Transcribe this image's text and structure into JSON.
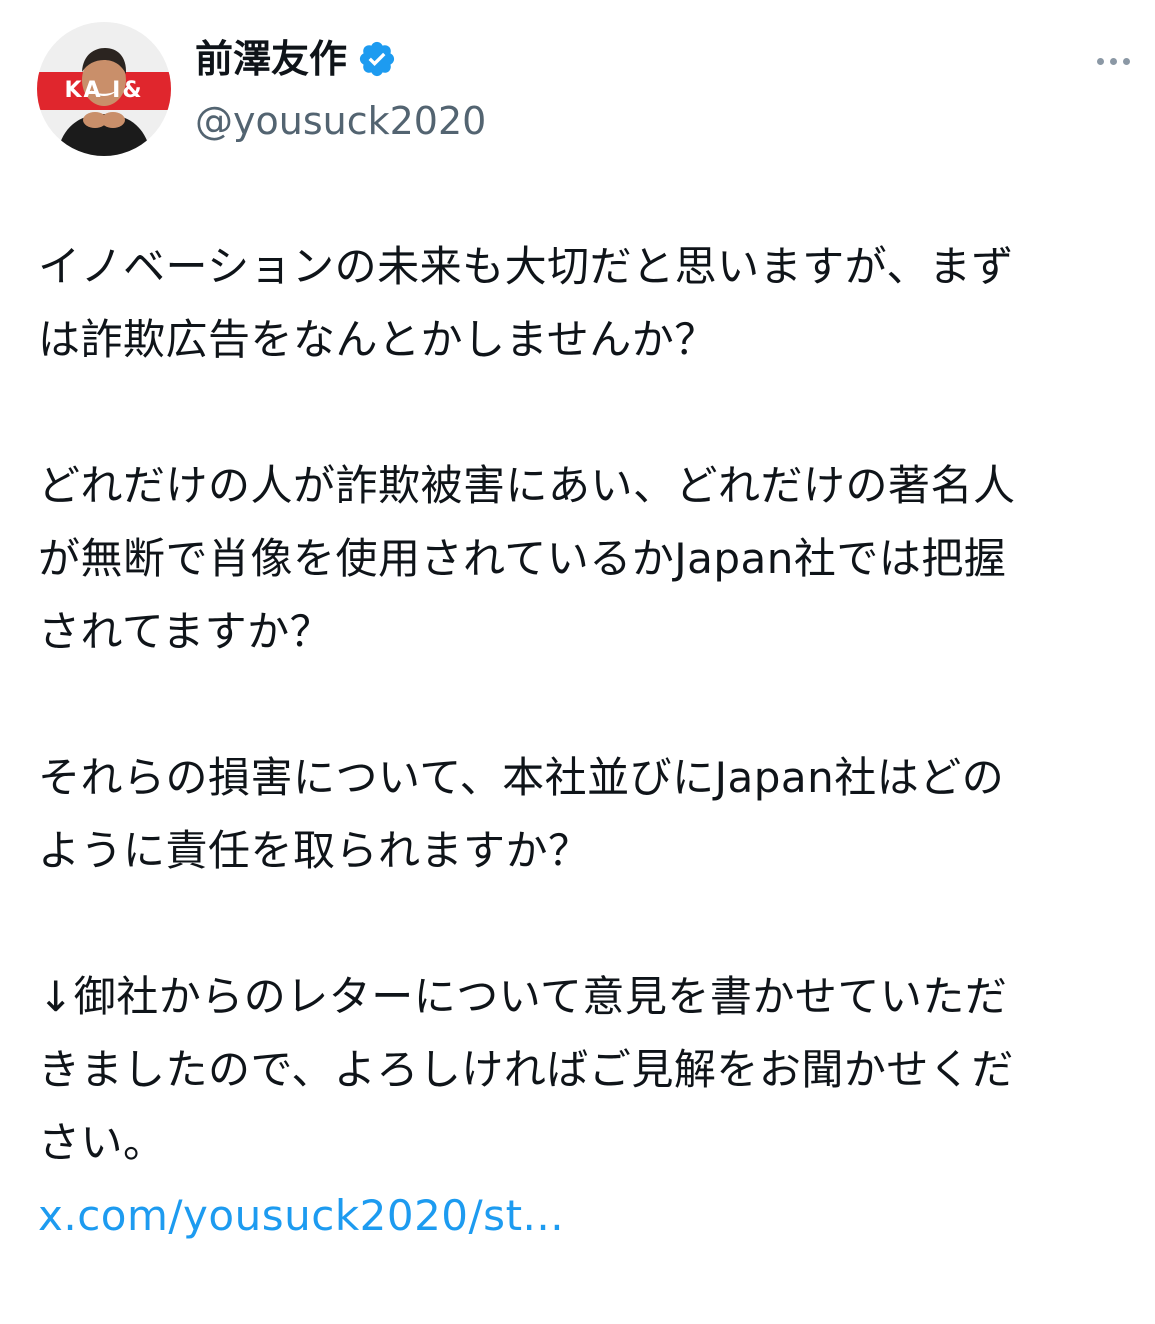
{
  "author": {
    "display_name": "前澤友作",
    "handle": "@yousuck2020",
    "verified": true,
    "avatar_banner_text": "KA  I&"
  },
  "tweet": {
    "paragraphs": [
      {
        "lines": [
          "イノベーションの未来も大切だと思いますが、まず",
          "は詐欺広告をなんとかしませんか？"
        ]
      },
      {
        "lines": [
          "どれだけの人が詐欺被害にあい、どれだけの著名人",
          "が無断で肖像を使用されているかJapan社では把握",
          "されてますか？"
        ]
      },
      {
        "lines": [
          "それらの損害について、本社並びにJapan社はどの",
          "ように責任を取られますか？"
        ]
      },
      {
        "lines": [
          "↓御社からのレターについて意見を書かせていただ",
          "きましたので、よろしければご見解をお聞かせくだ",
          "さい。"
        ]
      }
    ],
    "link_text": "x.com/yousuck2020/st..."
  },
  "colors": {
    "text": "#0f1419",
    "secondary": "#536471",
    "link": "#1d9bf0",
    "verified": "#1d9bf0"
  },
  "icons": {
    "verified": "verified-badge-icon",
    "more": "more-options-icon"
  }
}
